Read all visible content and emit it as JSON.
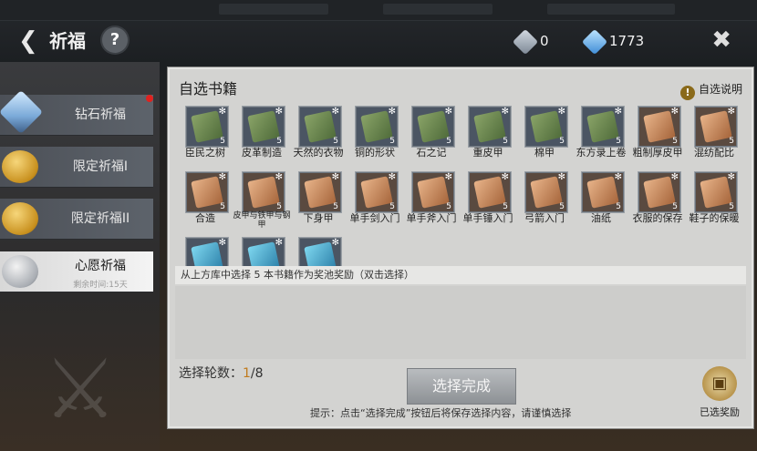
{
  "header": {
    "back_icon": "back-arrow-icon",
    "title": "祈福",
    "help_icon": "question-icon",
    "currencies": [
      {
        "icon": "silver-gem-icon",
        "value": "0"
      },
      {
        "icon": "blue-diamond-icon",
        "value": "1773"
      }
    ],
    "close_icon": "close-x-icon"
  },
  "sidebar": {
    "tabs": [
      {
        "label": "钻石祈福",
        "icon": "diamond-icon",
        "has_red_dot": true
      },
      {
        "label": "限定祈福I",
        "icon": "gold-coin-icon"
      },
      {
        "label": "限定祈福II",
        "icon": "gold-coin-icon"
      },
      {
        "label": "心愿祈福",
        "icon": "silver-coin-icon",
        "sub": "剩余时间:15天",
        "active": true
      }
    ]
  },
  "panel": {
    "title": "自选书籍",
    "explain_label": "自选说明",
    "books": [
      {
        "name": "臣民之树",
        "count": "5",
        "color": "green"
      },
      {
        "name": "皮革制造",
        "count": "5",
        "color": "green"
      },
      {
        "name": "天然的衣物",
        "count": "5",
        "color": "green"
      },
      {
        "name": "铜的形状",
        "count": "5",
        "color": "green"
      },
      {
        "name": "石之记",
        "count": "5",
        "color": "green"
      },
      {
        "name": "重皮甲",
        "count": "5",
        "color": "green"
      },
      {
        "name": "棉甲",
        "count": "5",
        "color": "green"
      },
      {
        "name": "东方录上卷",
        "count": "5",
        "color": "green"
      },
      {
        "name": "粗制厚皮甲",
        "count": "5",
        "color": "orange"
      },
      {
        "name": "混纺配比",
        "count": "5",
        "color": "orange"
      },
      {
        "name": "合造",
        "count": "5",
        "color": "orange"
      },
      {
        "name": "皮甲与铁甲与钢甲",
        "count": "5",
        "color": "orange"
      },
      {
        "name": "下身甲",
        "count": "5",
        "color": "orange"
      },
      {
        "name": "单手剑入门",
        "count": "5",
        "color": "orange"
      },
      {
        "name": "单手斧入门",
        "count": "5",
        "color": "orange"
      },
      {
        "name": "单手锤入门",
        "count": "5",
        "color": "orange"
      },
      {
        "name": "弓箭入门",
        "count": "5",
        "color": "orange"
      },
      {
        "name": "油纸",
        "count": "5",
        "color": "orange"
      },
      {
        "name": "衣服的保存",
        "count": "5",
        "color": "orange"
      },
      {
        "name": "鞋子的保暖",
        "count": "5",
        "color": "orange"
      },
      {
        "name": "",
        "count": "",
        "color": "blue"
      },
      {
        "name": "",
        "count": "",
        "color": "blue"
      },
      {
        "name": "",
        "count": "",
        "color": "blue"
      }
    ],
    "instruction": "从上方库中选择 5 本书籍作为奖池奖励（双击选择）",
    "rounds_label": "选择轮数：",
    "rounds_current": "1",
    "rounds_total": "/8",
    "confirm_label": "选择完成",
    "hint": "提示：点击“选择完成”按钮后将保存选择内容，请谨慎选择",
    "reward_label": "已选奖励"
  }
}
